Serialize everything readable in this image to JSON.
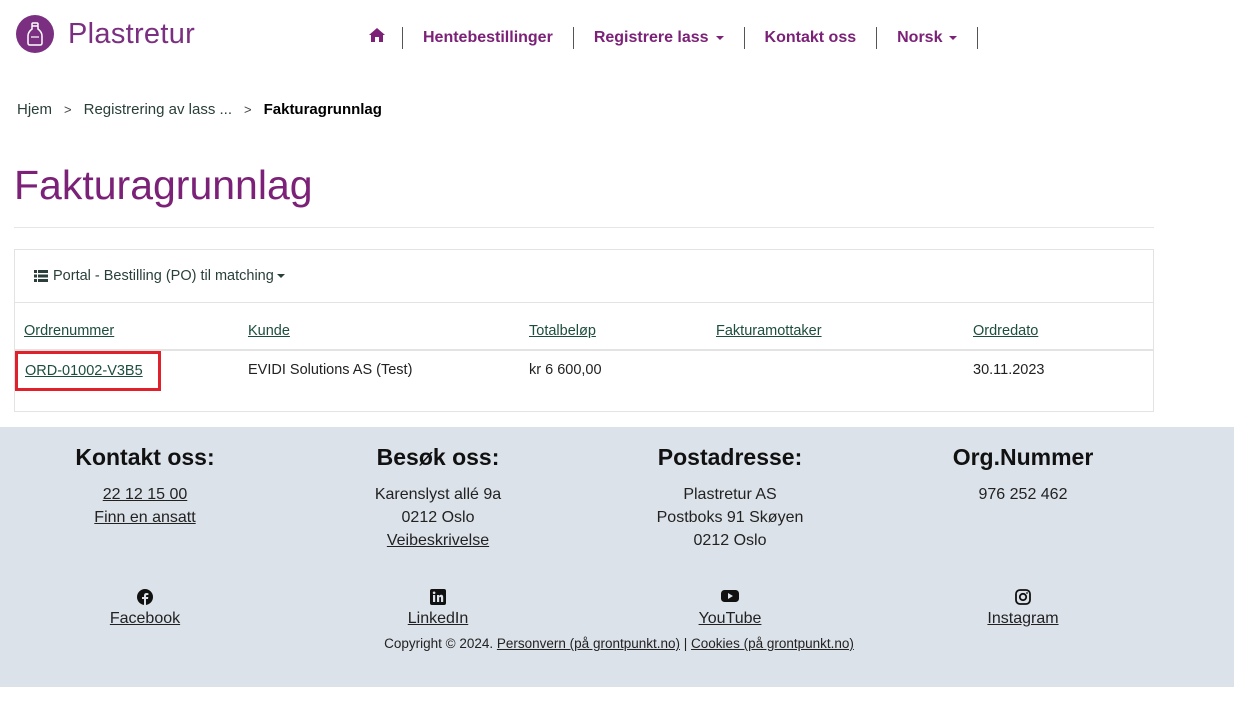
{
  "brand": {
    "name": "Plastretur",
    "color": "#7b2177"
  },
  "nav": {
    "home_icon": "home-icon",
    "items": [
      {
        "label": "Hentebestillinger",
        "dropdown": false
      },
      {
        "label": "Registrere lass",
        "dropdown": true
      },
      {
        "label": "Kontakt oss",
        "dropdown": false
      },
      {
        "label": "Norsk",
        "dropdown": true
      }
    ]
  },
  "breadcrumb": {
    "items": [
      "Hjem",
      "Registrering av lass ..."
    ],
    "separator": ">",
    "current": "Fakturagrunnlag"
  },
  "page": {
    "title": "Fakturagrunnlag"
  },
  "panel": {
    "view_selector": "Portal - Bestilling (PO) til matching",
    "columns": [
      "Ordrenummer",
      "Kunde",
      "Totalbeløp",
      "Fakturamottaker",
      "Ordredato"
    ],
    "rows": [
      {
        "order": "ORD-01002-V3B5",
        "customer": "EVIDI Solutions AS (Test)",
        "total": "kr 6 600,00",
        "recipient": "",
        "date": "30.11.2023"
      }
    ]
  },
  "footer": {
    "contact": {
      "title": "Kontakt oss:",
      "phone": "22 12 15 00",
      "find": "Finn en ansatt"
    },
    "visit": {
      "title": "Besøk oss:",
      "street": "Karenslyst allé 9a",
      "city": "0212 Oslo",
      "directions": "Veibeskrivelse"
    },
    "post": {
      "title": "Postadresse:",
      "line1": "Plastretur AS",
      "line2": "Postboks 91 Skøyen",
      "line3": "0212 Oslo"
    },
    "org": {
      "title": "Org.Nummer",
      "number": "976 252 462"
    },
    "social": [
      {
        "icon": "facebook-icon",
        "label": "Facebook"
      },
      {
        "icon": "linkedin-icon",
        "label": "LinkedIn"
      },
      {
        "icon": "youtube-icon",
        "label": "YouTube"
      },
      {
        "icon": "instagram-icon",
        "label": "Instagram"
      }
    ],
    "copyright": {
      "text": "Copyright © 2024.",
      "privacy": "Personvern (på grontpunkt.no)",
      "divider": "|",
      "cookies": "Cookies (på grontpunkt.no)"
    }
  }
}
